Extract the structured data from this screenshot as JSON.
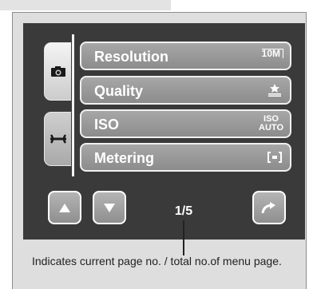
{
  "menu": {
    "items": [
      {
        "label": "Resolution",
        "value": "10M",
        "icon": "resolution-10m-icon"
      },
      {
        "label": "Quality",
        "value": "",
        "icon": "quality-stars-icon"
      },
      {
        "label": "ISO",
        "value_line1": "ISO",
        "value_line2": "AUTO",
        "icon": "iso-auto-icon"
      },
      {
        "label": "Metering",
        "value": "",
        "icon": "metering-center-icon"
      }
    ]
  },
  "tabs": [
    {
      "icon": "camera-icon"
    },
    {
      "icon": "wrench-icon"
    }
  ],
  "navigation": {
    "up_icon": "up-arrow-icon",
    "down_icon": "down-arrow-icon",
    "return_icon": "return-arrow-icon",
    "page_indicator": "1/5"
  },
  "caption": {
    "text": "Indicates current page no. / total no.of menu page."
  },
  "colors": {
    "screen_background": "#3a3a3a",
    "button_gray": "#9a9a9a",
    "frame_background": "#dedede"
  }
}
